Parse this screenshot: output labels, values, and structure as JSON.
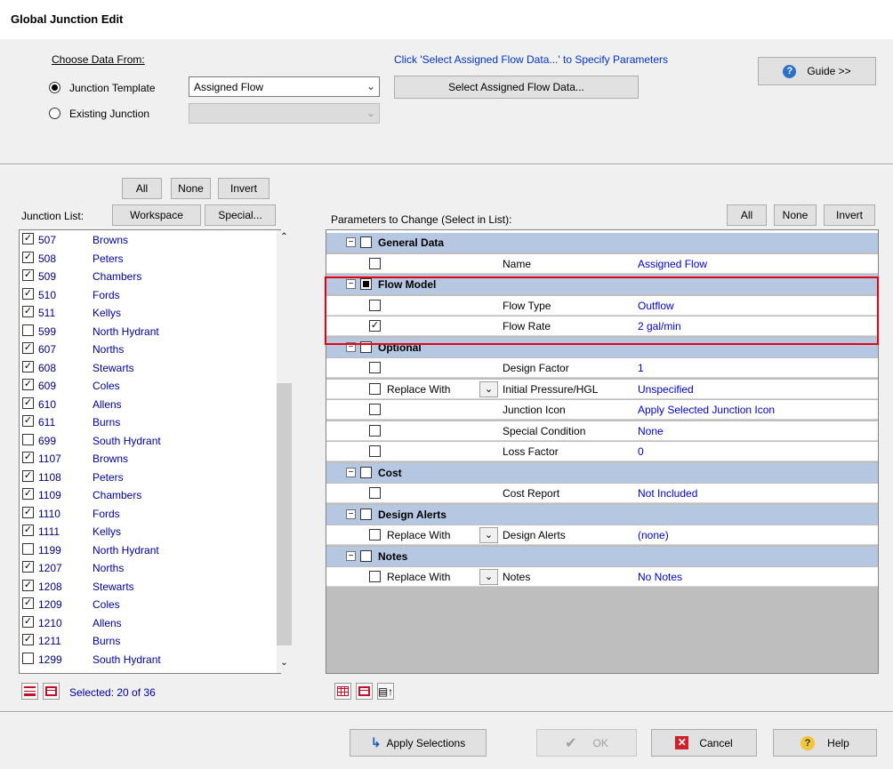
{
  "window": {
    "title": "Global Junction Edit"
  },
  "source": {
    "label": "Choose Data From:",
    "junction_template_label": "Junction Template",
    "existing_junction_label": "Existing Junction",
    "template_value": "Assigned Flow",
    "existing_value": "",
    "hint": "Click 'Select Assigned Flow Data...' to Specify Parameters",
    "select_button": "Select Assigned Flow Data...",
    "guide_button": "Guide >>"
  },
  "junction_list": {
    "label": "Junction List:",
    "all": "All",
    "none": "None",
    "invert": "Invert",
    "workspace": "Workspace",
    "special": "Special...",
    "selected_text": "Selected: 20 of 36",
    "items": [
      {
        "num": "507",
        "name": "Browns",
        "checked": true
      },
      {
        "num": "508",
        "name": "Peters",
        "checked": true
      },
      {
        "num": "509",
        "name": "Chambers",
        "checked": true
      },
      {
        "num": "510",
        "name": "Fords",
        "checked": true
      },
      {
        "num": "511",
        "name": "Kellys",
        "checked": true
      },
      {
        "num": "599",
        "name": "North Hydrant",
        "checked": false
      },
      {
        "num": "607",
        "name": "Norths",
        "checked": true
      },
      {
        "num": "608",
        "name": "Stewarts",
        "checked": true
      },
      {
        "num": "609",
        "name": "Coles",
        "checked": true
      },
      {
        "num": "610",
        "name": "Allens",
        "checked": true
      },
      {
        "num": "611",
        "name": "Burns",
        "checked": true
      },
      {
        "num": "699",
        "name": "South Hydrant",
        "checked": false
      },
      {
        "num": "1107",
        "name": "Browns",
        "checked": true
      },
      {
        "num": "1108",
        "name": "Peters",
        "checked": true
      },
      {
        "num": "1109",
        "name": "Chambers",
        "checked": true
      },
      {
        "num": "1110",
        "name": "Fords",
        "checked": true
      },
      {
        "num": "1111",
        "name": "Kellys",
        "checked": true
      },
      {
        "num": "1199",
        "name": "North Hydrant",
        "checked": false
      },
      {
        "num": "1207",
        "name": "Norths",
        "checked": true
      },
      {
        "num": "1208",
        "name": "Stewarts",
        "checked": true
      },
      {
        "num": "1209",
        "name": "Coles",
        "checked": true
      },
      {
        "num": "1210",
        "name": "Allens",
        "checked": true
      },
      {
        "num": "1211",
        "name": "Burns",
        "checked": true
      },
      {
        "num": "1299",
        "name": "South Hydrant",
        "checked": false
      }
    ]
  },
  "parameters": {
    "label": "Parameters to Change (Select in List):",
    "all": "All",
    "none": "None",
    "invert": "Invert",
    "rows": [
      {
        "kind": "cat",
        "title": "General Data",
        "state": "none"
      },
      {
        "kind": "row",
        "name": "Name",
        "value": "Assigned Flow",
        "checked": false,
        "replace": false
      },
      {
        "kind": "cat",
        "title": "Flow Model",
        "state": "partial"
      },
      {
        "kind": "row",
        "name": "Flow Type",
        "value": "Outflow",
        "checked": false,
        "replace": false
      },
      {
        "kind": "row",
        "name": "Flow Rate",
        "value": "2 gal/min",
        "checked": true,
        "replace": false
      },
      {
        "kind": "cat",
        "title": "Optional",
        "state": "none"
      },
      {
        "kind": "row",
        "name": "Design Factor",
        "value": "1",
        "checked": false,
        "replace": false
      },
      {
        "kind": "row",
        "name": "Initial Pressure/HGL",
        "value": "Unspecified",
        "checked": false,
        "replace": true
      },
      {
        "kind": "row",
        "name": "Junction Icon",
        "value": "Apply Selected Junction Icon",
        "checked": false,
        "replace": false
      },
      {
        "kind": "row",
        "name": "Special Condition",
        "value": "None",
        "checked": false,
        "replace": false
      },
      {
        "kind": "row",
        "name": "Loss Factor",
        "value": "0",
        "checked": false,
        "replace": false
      },
      {
        "kind": "cat",
        "title": "Cost",
        "state": "none"
      },
      {
        "kind": "row",
        "name": "Cost Report",
        "value": "Not Included",
        "checked": false,
        "replace": false
      },
      {
        "kind": "cat",
        "title": "Design Alerts",
        "state": "none"
      },
      {
        "kind": "row",
        "name": "Design Alerts",
        "value": "(none)",
        "checked": false,
        "replace": true
      },
      {
        "kind": "cat",
        "title": "Notes",
        "state": "none"
      },
      {
        "kind": "row",
        "name": "Notes",
        "value": "No Notes",
        "checked": false,
        "replace": true
      }
    ],
    "replace_label": "Replace With"
  },
  "footer": {
    "apply": "Apply Selections",
    "ok": "OK",
    "cancel": "Cancel",
    "help": "Help"
  },
  "colors": {
    "accent_red": "#e3000f",
    "category_bg": "#b5c7e1",
    "value_blue": "#0000cc"
  }
}
